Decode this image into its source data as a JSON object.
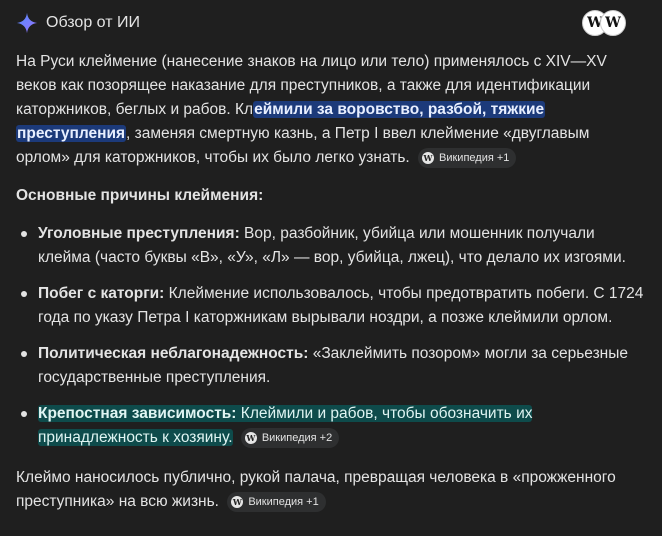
{
  "header": {
    "title": "Обзор от ИИ",
    "icon": "sparkle-icon",
    "accent": "#4285f4"
  },
  "sources_icon": {
    "letter": "W",
    "icon": "wikipedia-icon"
  },
  "paragraph1": {
    "line1": "На Руси клеймение (нанесение знаков на лицо или тело) применялось с XIV—XV",
    "line2": "веков как позорящее наказание для преступников, а также для идентификации",
    "line3_pre": "каторжников, беглых и рабов. Кл",
    "line3_hl": "еймили за воровство, разбой, тяжкие",
    "line4_hl": "преступления",
    "line4_post": ", заменяя смертную казнь, а Петр I ввел клеймение «двуглавым",
    "line5": "орлом» для каторжников, чтобы их было легко узнать.",
    "chip": "Википедия +1"
  },
  "subhead": "Основные причины клеймения:",
  "items": [
    {
      "label": "Уголовные преступления:",
      "l1": " Вор, разбойник, убийца или мошенник получали",
      "l2": "клейма (часто буквы «В», «У», «Л» — вор, убийца, лжец), что делало их изгоями."
    },
    {
      "label": "Побег с каторги:",
      "l1": " Клеймение использовалось, чтобы предотвратить побеги. С 1724",
      "l2": "года по указу Петра I каторжникам вырывали ноздри, а позже клеймили орлом."
    },
    {
      "label": "Политическая неблагонадежность:",
      "l1": " «Заклеймить позором» могли за серьезные",
      "l2": "государственные преступления."
    },
    {
      "label": "Крепостная зависимость:",
      "l1": " Клеймили и рабов, чтобы обозначить их",
      "l2": "принадлежность к хозяину.",
      "chip": "Википедия +2"
    }
  ],
  "final": {
    "l1": "Клеймо наносилось публично, рукой палача, превращая человека в «прожженного",
    "l2": "преступника» на всю жизнь.",
    "chip": "Википедия +1"
  }
}
